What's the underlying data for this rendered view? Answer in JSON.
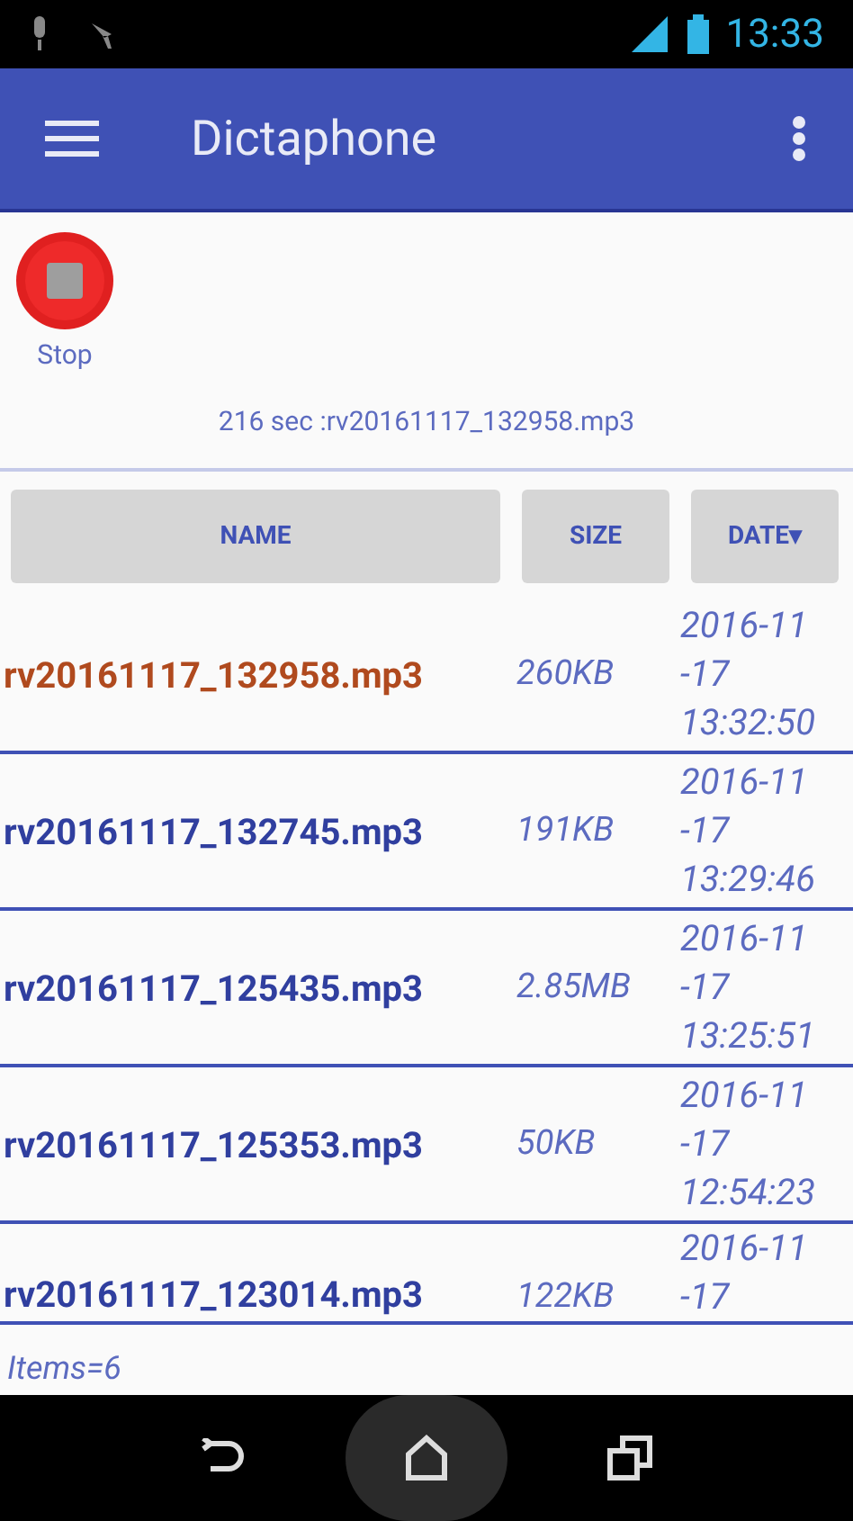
{
  "status_bar": {
    "time": "13:33"
  },
  "app_bar": {
    "title": "Dictaphone"
  },
  "recorder": {
    "button_label": "Stop",
    "status": "216 sec :rv20161117_132958.mp3"
  },
  "table": {
    "columns": [
      {
        "label": "NAME"
      },
      {
        "label": "SIZE"
      },
      {
        "label": "DATE▾"
      }
    ],
    "rows": [
      {
        "name": "rv20161117_132958.mp3",
        "size": "260KB",
        "date": [
          "2016-11",
          "-17",
          "13:32:50"
        ],
        "selected": true
      },
      {
        "name": "rv20161117_132745.mp3",
        "size": "191KB",
        "date": [
          "2016-11",
          "-17",
          "13:29:46"
        ],
        "selected": false
      },
      {
        "name": "rv20161117_125435.mp3",
        "size": "2.85MB",
        "date": [
          "2016-11",
          "-17",
          "13:25:51"
        ],
        "selected": false
      },
      {
        "name": "rv20161117_125353.mp3",
        "size": "50KB",
        "date": [
          "2016-11",
          "-17",
          "12:54:23"
        ],
        "selected": false
      },
      {
        "name": "rv20161117_123014.mp3",
        "size": "122KB",
        "date": [
          "2016-11",
          "-17"
        ],
        "selected": false
      }
    ]
  },
  "footer": "Items=6"
}
